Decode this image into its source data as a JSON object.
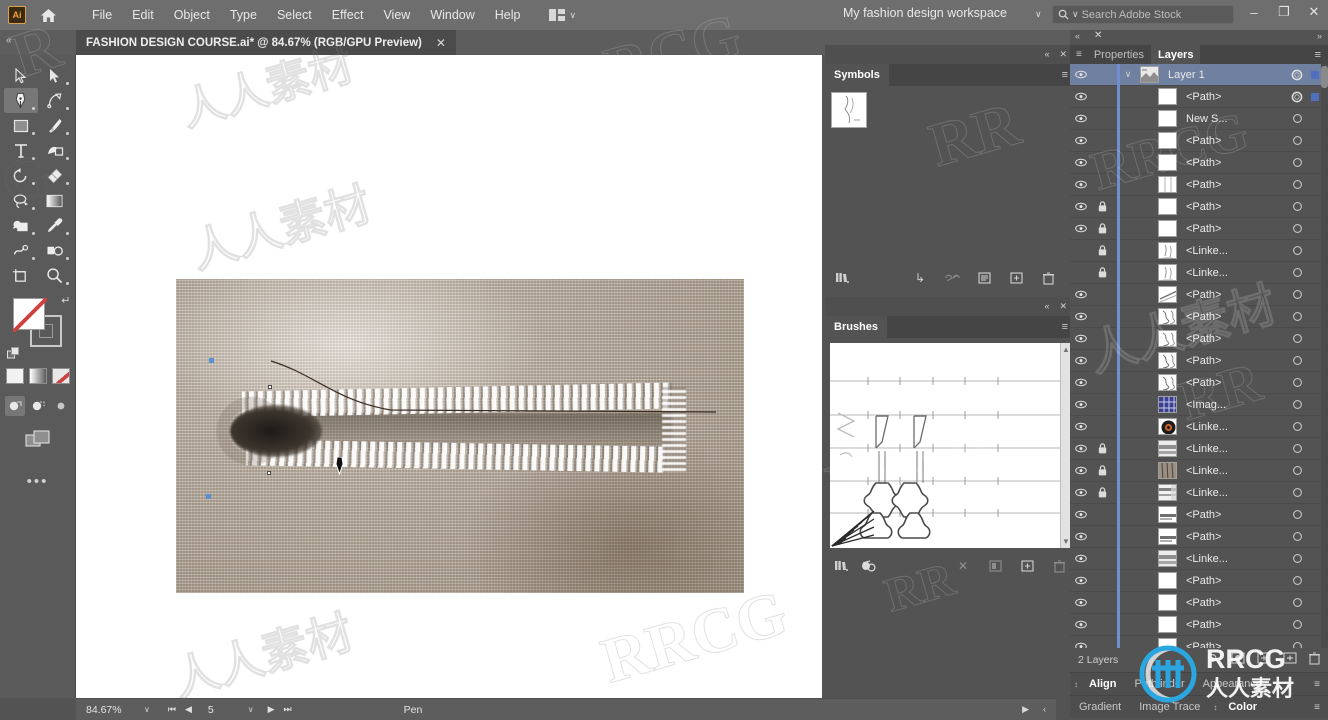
{
  "app": {
    "name": "Adobe Illustrator",
    "logo_text": "Ai",
    "home_icon": "home-icon"
  },
  "menubar": {
    "items": [
      "File",
      "Edit",
      "Object",
      "Type",
      "Select",
      "Effect",
      "View",
      "Window",
      "Help"
    ],
    "arrange_icon": "arrange-documents-icon",
    "arrange_chevron": "∨",
    "workspace": "My fashion design workspace",
    "workspace_chevron": "∨",
    "search": {
      "icon": "search-icon",
      "chevron": "∨",
      "placeholder": "Search Adobe Stock",
      "value": ""
    },
    "window_controls": {
      "minimize": "–",
      "restore": "❐",
      "close": "✕"
    }
  },
  "tabbar": {
    "collapse": "«",
    "expand": "»",
    "document_title": "FASHION DESIGN COURSE.ai* @ 84.67% (RGB/GPU Preview)",
    "close": "✕"
  },
  "toolbar": {
    "tools": [
      {
        "name": "selection-tool",
        "active": false
      },
      {
        "name": "direct-selection-tool",
        "active": false
      },
      {
        "name": "pen-tool",
        "active": true
      },
      {
        "name": "curvature-tool",
        "active": false
      },
      {
        "name": "rectangle-tool",
        "active": false
      },
      {
        "name": "paintbrush-tool",
        "active": false
      },
      {
        "name": "type-tool",
        "active": false
      },
      {
        "name": "shaper-tool",
        "active": false
      },
      {
        "name": "rotate-tool",
        "active": false
      },
      {
        "name": "eraser-tool",
        "active": false
      },
      {
        "name": "lasso-tool",
        "active": false
      },
      {
        "name": "gradient-tool",
        "active": false
      },
      {
        "name": "shape-builder-tool",
        "active": false
      },
      {
        "name": "eyedropper-tool",
        "active": false
      },
      {
        "name": "width-tool",
        "active": false
      },
      {
        "name": "blend-tool",
        "active": false
      },
      {
        "name": "artboard-tool",
        "active": false
      },
      {
        "name": "zoom-tool",
        "active": false
      }
    ],
    "fill_label": "Fill: None",
    "stroke_label": "Stroke",
    "swap_icon": "swap-fill-stroke-icon",
    "color_modes": [
      "color-swatch",
      "gradient-swatch",
      "none-swatch"
    ],
    "draw_modes": [
      "draw-normal",
      "draw-behind",
      "draw-inside"
    ],
    "screen_mode": "change-screen-mode-icon",
    "more_tools": "•••"
  },
  "statusbar": {
    "zoom": "84.67%",
    "zoom_chevron": "∨",
    "first": "⏮",
    "prev": "◀",
    "page": "5",
    "page_chevron": "∨",
    "next": "▶",
    "last": "⏭",
    "tool_name": "Pen",
    "scroll_right": "▶",
    "scroll_more": "‹"
  },
  "symbols_panel": {
    "mini_collapse": "«",
    "mini_close": "✕",
    "title": "Symbols",
    "menu_icon": "panel-menu-icon",
    "items": [
      {
        "name": "symbol-thumb-1"
      }
    ],
    "footer_icons": [
      "symbol-libraries-icon",
      "place-symbol-instance-icon",
      "break-link-icon",
      "symbol-options-icon",
      "new-symbol-icon",
      "delete-symbol-icon"
    ]
  },
  "brushes_panel": {
    "mini_collapse": "«",
    "mini_close": "✕",
    "title": "Brushes",
    "menu_icon": "panel-menu-icon",
    "footer_icons": [
      "brush-libraries-icon",
      "libraries-panel-icon",
      "remove-brush-stroke-icon",
      "options-of-selected-object-icon",
      "new-brush-icon",
      "delete-brush-icon"
    ]
  },
  "dock": {
    "mini_collapse": "«",
    "mini_close": "✕",
    "mini_expand": "»",
    "tabs": [
      {
        "label": "Properties",
        "active": false
      },
      {
        "label": "Layers",
        "active": true
      }
    ],
    "menu_icon": "panel-menu-icon",
    "layers_count": "2 Layers",
    "footer_icons": [
      "locate-object-icon",
      "make-clipping-mask-icon",
      "create-new-sublayer-icon",
      "create-new-layer-icon",
      "delete-selection-icon"
    ],
    "bottom_strips": [
      {
        "tabs": [
          "Align",
          "Pathfinder",
          "Appearance"
        ],
        "active": "Align"
      },
      {
        "tabs": [
          "Gradient",
          "Image Trace",
          "Color"
        ],
        "active": "Color"
      }
    ],
    "layers": [
      {
        "name": "Layer 1",
        "type": "layer",
        "visible": true,
        "locked": false,
        "selected": true,
        "has_target_ring": true,
        "has_select_box": true,
        "indent": 0,
        "thumb": "art"
      },
      {
        "name": "<Path>",
        "type": "path",
        "visible": true,
        "locked": false,
        "selected": false,
        "has_target_ring": true,
        "has_select_box": true,
        "indent": 1,
        "thumb": "blank"
      },
      {
        "name": "New S...",
        "type": "symbol",
        "visible": true,
        "locked": false,
        "selected": false,
        "has_target_ring": false,
        "has_select_box": false,
        "indent": 1,
        "thumb": "blank"
      },
      {
        "name": "<Path>",
        "type": "path",
        "visible": true,
        "locked": false,
        "selected": false,
        "has_target_ring": false,
        "has_select_box": false,
        "indent": 1,
        "thumb": "blank"
      },
      {
        "name": "<Path>",
        "type": "path",
        "visible": true,
        "locked": false,
        "selected": false,
        "has_target_ring": false,
        "has_select_box": false,
        "indent": 1,
        "thumb": "blank"
      },
      {
        "name": "<Path>",
        "type": "path",
        "visible": true,
        "locked": false,
        "selected": false,
        "has_target_ring": false,
        "has_select_box": false,
        "indent": 1,
        "thumb": "lines"
      },
      {
        "name": "<Path>",
        "type": "path",
        "visible": true,
        "locked": true,
        "selected": false,
        "has_target_ring": false,
        "has_select_box": false,
        "indent": 1,
        "thumb": "blank"
      },
      {
        "name": "<Path>",
        "type": "path",
        "visible": true,
        "locked": true,
        "selected": false,
        "has_target_ring": false,
        "has_select_box": false,
        "indent": 1,
        "thumb": "blank"
      },
      {
        "name": "<Linke...",
        "type": "linked",
        "visible": false,
        "locked": true,
        "selected": false,
        "has_target_ring": false,
        "has_select_box": false,
        "indent": 1,
        "thumb": "sketch"
      },
      {
        "name": "<Linke...",
        "type": "linked",
        "visible": false,
        "locked": true,
        "selected": false,
        "has_target_ring": false,
        "has_select_box": false,
        "indent": 1,
        "thumb": "sketch"
      },
      {
        "name": "<Path>",
        "type": "path",
        "visible": true,
        "locked": false,
        "selected": false,
        "has_target_ring": false,
        "has_select_box": false,
        "indent": 1,
        "thumb": "diag"
      },
      {
        "name": "<Path>",
        "type": "path",
        "visible": true,
        "locked": false,
        "selected": false,
        "has_target_ring": false,
        "has_select_box": false,
        "indent": 1,
        "thumb": "scribble"
      },
      {
        "name": "<Path>",
        "type": "path",
        "visible": true,
        "locked": false,
        "selected": false,
        "has_target_ring": false,
        "has_select_box": false,
        "indent": 1,
        "thumb": "scribble"
      },
      {
        "name": "<Path>",
        "type": "path",
        "visible": true,
        "locked": false,
        "selected": false,
        "has_target_ring": false,
        "has_select_box": false,
        "indent": 1,
        "thumb": "scribble"
      },
      {
        "name": "<Path>",
        "type": "path",
        "visible": true,
        "locked": false,
        "selected": false,
        "has_target_ring": false,
        "has_select_box": false,
        "indent": 1,
        "thumb": "scribble"
      },
      {
        "name": "<Imag...",
        "type": "image",
        "visible": true,
        "locked": false,
        "selected": false,
        "has_target_ring": false,
        "has_select_box": false,
        "indent": 1,
        "thumb": "grid"
      },
      {
        "name": "<Linke...",
        "type": "linked",
        "visible": true,
        "locked": false,
        "selected": false,
        "has_target_ring": false,
        "has_select_box": false,
        "indent": 1,
        "thumb": "ring"
      },
      {
        "name": "<Linke...",
        "type": "linked",
        "visible": true,
        "locked": true,
        "selected": false,
        "has_target_ring": false,
        "has_select_box": false,
        "indent": 1,
        "thumb": "photo"
      },
      {
        "name": "<Linke...",
        "type": "linked",
        "visible": true,
        "locked": true,
        "selected": false,
        "has_target_ring": false,
        "has_select_box": false,
        "indent": 1,
        "thumb": "photo2"
      },
      {
        "name": "<Linke...",
        "type": "linked",
        "visible": true,
        "locked": true,
        "selected": false,
        "has_target_ring": false,
        "has_select_box": false,
        "indent": 1,
        "thumb": "photo3"
      },
      {
        "name": "<Path>",
        "type": "path",
        "visible": true,
        "locked": false,
        "selected": false,
        "has_target_ring": false,
        "has_select_box": false,
        "indent": 1,
        "thumb": "bar"
      },
      {
        "name": "<Path>",
        "type": "path",
        "visible": true,
        "locked": false,
        "selected": false,
        "has_target_ring": false,
        "has_select_box": false,
        "indent": 1,
        "thumb": "bar"
      },
      {
        "name": "<Linke...",
        "type": "linked",
        "visible": true,
        "locked": false,
        "selected": false,
        "has_target_ring": false,
        "has_select_box": false,
        "indent": 1,
        "thumb": "photo"
      },
      {
        "name": "<Path>",
        "type": "path",
        "visible": true,
        "locked": false,
        "selected": false,
        "has_target_ring": false,
        "has_select_box": false,
        "indent": 1,
        "thumb": "blank"
      },
      {
        "name": "<Path>",
        "type": "path",
        "visible": true,
        "locked": false,
        "selected": false,
        "has_target_ring": false,
        "has_select_box": false,
        "indent": 1,
        "thumb": "blank"
      },
      {
        "name": "<Path>",
        "type": "path",
        "visible": true,
        "locked": false,
        "selected": false,
        "has_target_ring": false,
        "has_select_box": false,
        "indent": 1,
        "thumb": "blank"
      },
      {
        "name": "<Path>",
        "type": "path",
        "visible": true,
        "locked": false,
        "selected": false,
        "has_target_ring": false,
        "has_select_box": false,
        "indent": 1,
        "thumb": "blank"
      }
    ]
  },
  "canvas": {
    "artwork_description": "Close-up photograph of a hand-stitched buttonhole on woven fabric",
    "pen_cursor": "pen-tool-cursor"
  },
  "watermarks": {
    "brand": "RRCG",
    "cn": "人人素材"
  },
  "colors": {
    "chrome": "#535353",
    "menubar": "#6e6e6e",
    "panel_tab_bar": "#454545",
    "selection_blue": "#6f80a0",
    "accent_blue": "#4f6fbf",
    "canvas": "#ffffff",
    "logo_orange": "#f0a13c"
  }
}
